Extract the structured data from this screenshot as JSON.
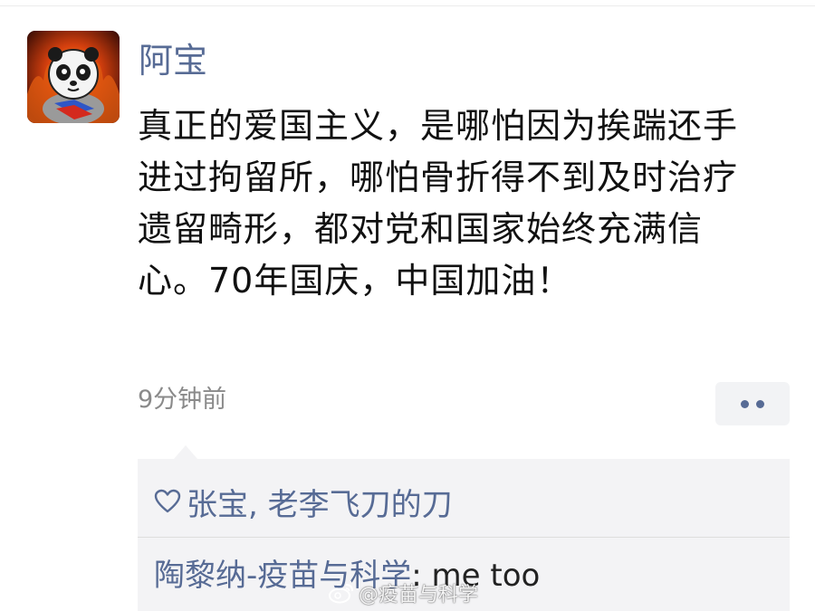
{
  "post": {
    "author": "阿宝",
    "text": "真正的爱国主义，是哪怕因为挨踹还手进过拘留所，哪怕骨折得不到及时治疗遗留畸形，都对党和国家始终充满信心。70年国庆，中国加油！",
    "timestamp": "9分钟前"
  },
  "likes": {
    "icon": "heart-outline-icon",
    "names": "张宝, 老李飞刀的刀"
  },
  "comments": [
    {
      "author": "陶黎纳-疫苗与科学",
      "separator": ": ",
      "text": "me too"
    }
  ],
  "watermark": {
    "text": "@疫苗与科学"
  },
  "colors": {
    "link": "#576b95",
    "text": "#111111",
    "meta": "#8a8a8a",
    "panel": "#f3f3f5"
  }
}
